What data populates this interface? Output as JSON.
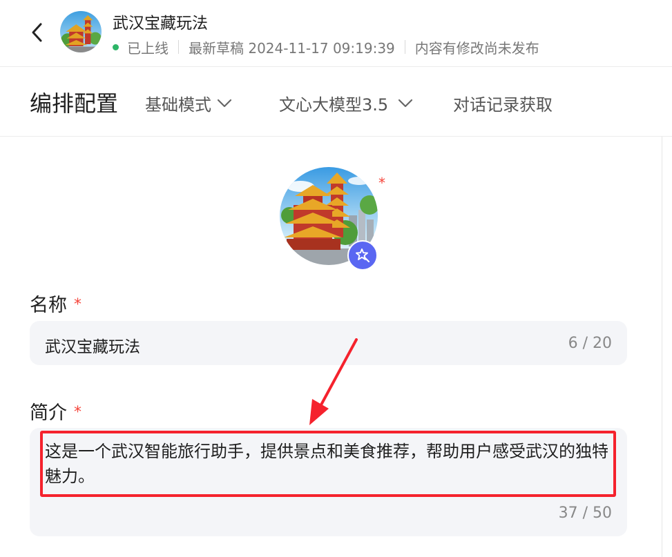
{
  "header": {
    "back_icon": "chevron-left-icon",
    "app_title": "武汉宝藏玩法",
    "status": "已上线",
    "status_color": "#2db567",
    "draft": "最新草稿 2024-11-17 09:19:39",
    "unpublished": "内容有修改尚未发布"
  },
  "toolbar": {
    "title": "编排配置",
    "mode": "基础模式",
    "model": "文心大模型3.5",
    "history": "对话记录获取"
  },
  "avatar": {
    "required_mark": "*",
    "magic_icon": "magic-wand-icon",
    "accent": "#5a67f2"
  },
  "form": {
    "name": {
      "label": "名称",
      "required_mark": "*",
      "value": "武汉宝藏玩法",
      "counter": "6 / 20"
    },
    "description": {
      "label": "简介",
      "required_mark": "*",
      "value": "这是一个武汉智能旅行助手，提供景点和美食推荐，帮助用户感受武汉的独特魅力。",
      "counter": "37 / 50"
    }
  },
  "annotation": {
    "color": "#f5222d"
  }
}
